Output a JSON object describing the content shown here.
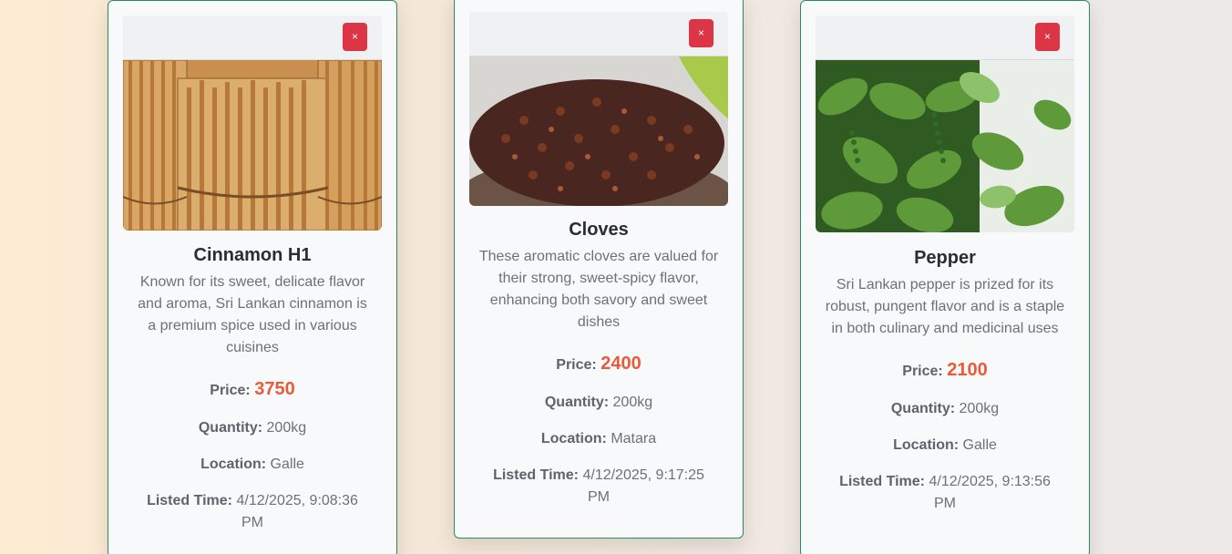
{
  "cards": [
    {
      "delete_label": "×",
      "image_icon": "cinnamon-sticks-image",
      "title": "Cinnamon H1",
      "description": "Known for its sweet, delicate flavor and aroma, Sri Lankan cinnamon is a premium spice used in various cuisines",
      "price_label": "Price:",
      "price": "3750",
      "quantity_label": "Quantity:",
      "quantity": "200kg",
      "location_label": "Location:",
      "location": "Galle",
      "time_label": "Listed Time:",
      "time": "4/12/2025, 9:08:36 PM"
    },
    {
      "delete_label": "×",
      "image_icon": "cloves-bowl-image",
      "title": "Cloves",
      "description": "These aromatic cloves are valued for their strong, sweet-spicy flavor, enhancing both savory and sweet dishes",
      "price_label": "Price:",
      "price": "2400",
      "quantity_label": "Quantity:",
      "quantity": "200kg",
      "location_label": "Location:",
      "location": "Matara",
      "time_label": "Listed Time:",
      "time": "4/12/2025, 9:17:25 PM"
    },
    {
      "delete_label": "×",
      "image_icon": "pepper-vine-image",
      "title": "Pepper",
      "description": "Sri Lankan pepper is prized for its robust, pungent flavor and is a staple in both culinary and medicinal uses",
      "price_label": "Price:",
      "price": "2100",
      "quantity_label": "Quantity:",
      "quantity": "200kg",
      "location_label": "Location:",
      "location": "Galle",
      "time_label": "Listed Time:",
      "time": "4/12/2025, 9:13:56 PM"
    }
  ],
  "colors": {
    "card_border": "#2e8b57",
    "delete_button": "#dc3545",
    "price": "#ea5a38"
  }
}
